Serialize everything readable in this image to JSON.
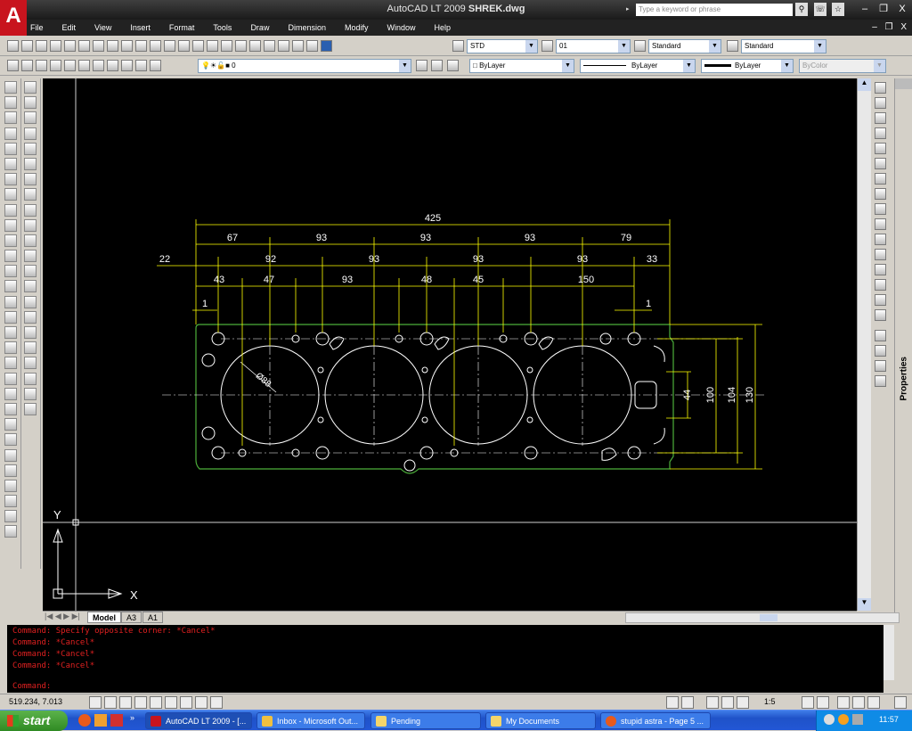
{
  "window": {
    "app_logo": "A",
    "title": "AutoCAD LT 2009 ",
    "drawing": "SHREK.dwg",
    "search_placeholder": "Type a keyword or phrase",
    "minimize": "–",
    "restore": "❐",
    "close": "X"
  },
  "menu": [
    "File",
    "Edit",
    "View",
    "Insert",
    "Format",
    "Tools",
    "Draw",
    "Dimension",
    "Modify",
    "Window",
    "Help"
  ],
  "toolbar": {
    "text_style": "STD",
    "dim_style": "01",
    "table_style": "Standard",
    "mleader_style": "Standard",
    "layer": "0",
    "color": "ByLayer",
    "linetype": "ByLayer",
    "lineweight": "ByLayer",
    "plotstyle": "ByColor"
  },
  "ucs": {
    "y": "Y",
    "x": "X"
  },
  "dimensions": {
    "overall": "425",
    "row1": [
      "67",
      "93",
      "93",
      "93",
      "79"
    ],
    "row2_left": "22",
    "row2": [
      "92",
      "93",
      "93",
      "93",
      "33"
    ],
    "row3": [
      "43",
      "47",
      "93",
      "48",
      "45",
      "150"
    ],
    "row4_left": "1",
    "row4_right": "1",
    "diameter": "Ø88",
    "vertical": [
      "44",
      "100",
      "104",
      "130"
    ]
  },
  "tabs": [
    "Model",
    "A3",
    "A1"
  ],
  "command_lines": [
    "Command: Specify opposite corner: *Cancel*",
    "Command: *Cancel*",
    "Command: *Cancel*",
    "Command: *Cancel*"
  ],
  "command_prompt": "Command:",
  "status": {
    "coordinates": "519.234, 7.013",
    "annotation_scale": "1:5"
  },
  "properties_label": "Properties",
  "taskbar": {
    "start": "start",
    "tasks": [
      "AutoCAD LT 2009 - [...",
      "Inbox - Microsoft Out...",
      "Pending",
      "My Documents",
      "stupid astra - Page 5 ..."
    ],
    "language": "EN",
    "clock": "11:57"
  },
  "colors": {
    "canvas": "#000000",
    "dimension": "#ffff00",
    "outline": "#4caf3a",
    "geometry": "#ffffff",
    "command_text": "#e02020",
    "taskbar": "#245edb"
  }
}
